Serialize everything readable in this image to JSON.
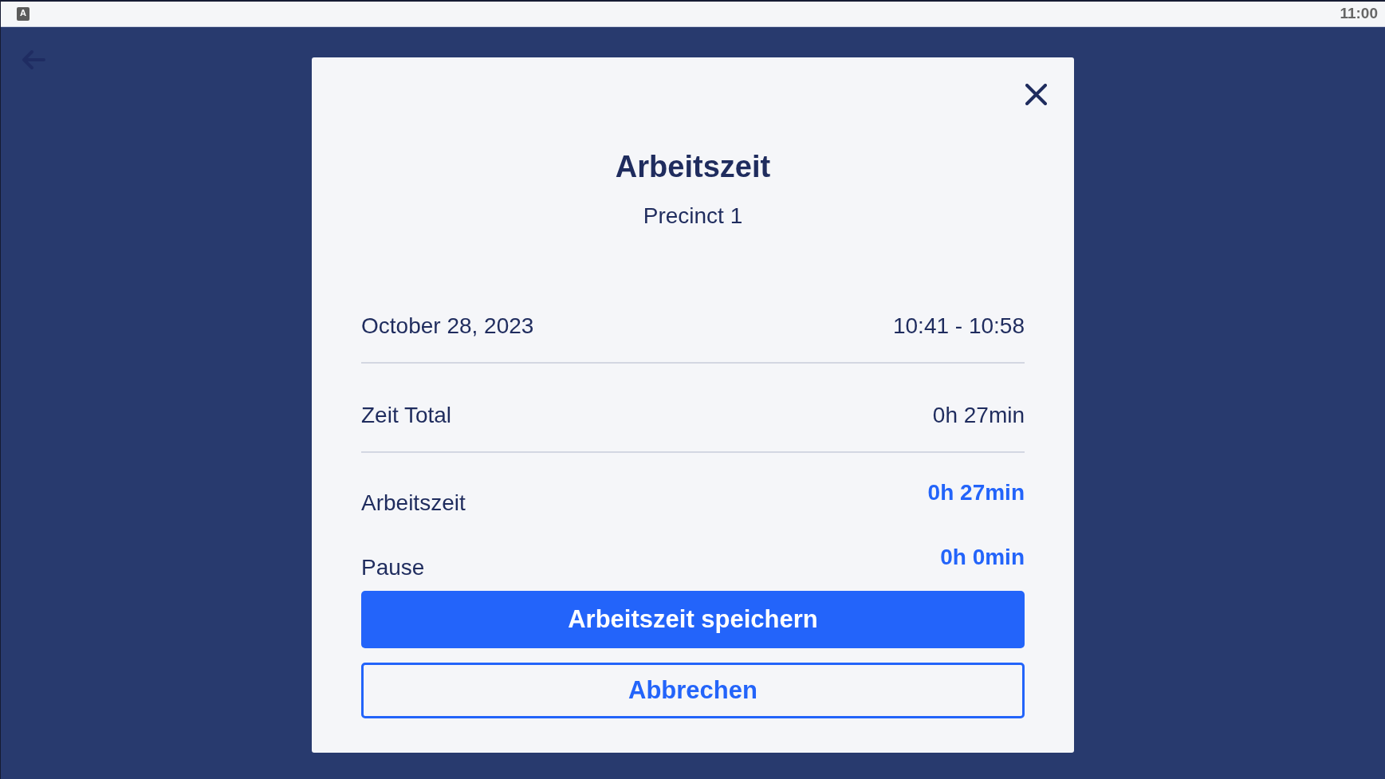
{
  "status_bar": {
    "indicator": "A",
    "time": "11:00"
  },
  "dialog": {
    "title": "Arbeitszeit",
    "subtitle": "Precinct 1",
    "rows": [
      {
        "kind": "plain",
        "label": "October 28, 2023",
        "value": "10:41 - 10:58"
      },
      {
        "kind": "plain",
        "label": "Zeit Total",
        "value": "0h 27min"
      },
      {
        "kind": "highlight",
        "label": "Arbeitszeit",
        "value": "0h 27min"
      },
      {
        "kind": "highlight",
        "label": "Pause",
        "value": "0h 0min"
      }
    ],
    "buttons": [
      {
        "kind": "primary",
        "label": "Arbeitszeit speichern"
      },
      {
        "kind": "secondary",
        "label": "Abbrechen"
      }
    ]
  }
}
